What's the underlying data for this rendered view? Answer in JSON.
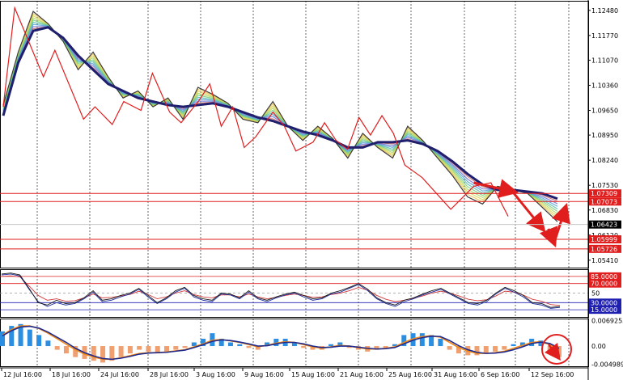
{
  "colors": {
    "background": "#ffffff",
    "price_line": "#3a3a3a",
    "slow_ma": "#1f1f6e",
    "zigzag": "#e01e1e",
    "level_line": "#e01e1e",
    "current_line": "#c8c8c8",
    "rsi_black": "#1a1a1a",
    "rsi_blue": "#1e2f9c",
    "rsi_red": "#d23c3c",
    "macd_pos": "#2b8ee0",
    "macd_neg": "#f0a070",
    "macd_signal": "#f08a1a",
    "macd_line": "#1f2a8e",
    "oscillator_level_line": "#2020b0"
  },
  "chart_data": [
    {
      "type": "line",
      "panel": "main",
      "dates": [
        "12 Jul 16:00",
        "18 Jul 16:00",
        "24 Jul 16:00",
        "28 Jul 16:00",
        "3 Aug 16:00",
        "9 Aug 16:00",
        "15 Aug 16:00",
        "21 Aug 16:00",
        "25 Aug 16:00",
        "31 Aug 16:00",
        "6 Sep 16:00",
        "12 Sep 16:00"
      ],
      "y_ticks": [
        "1.12480",
        "1.11770",
        "1.11070",
        "1.10360",
        "1.09650",
        "1.08950",
        "1.08240",
        "1.07530",
        "1.06830",
        "1.06120",
        "1.05410"
      ],
      "ylim": [
        1.052,
        1.1275
      ],
      "price": [
        1.098,
        1.113,
        1.1245,
        1.121,
        1.116,
        1.108,
        1.113,
        1.106,
        1.1,
        1.102,
        1.0975,
        1.1,
        1.094,
        1.103,
        1.101,
        1.0985,
        1.094,
        1.093,
        1.099,
        1.092,
        1.088,
        1.092,
        1.0885,
        1.083,
        1.09,
        1.086,
        1.083,
        1.092,
        1.088,
        1.083,
        1.078,
        1.072,
        1.07,
        1.075,
        1.074,
        1.073,
        1.069,
        1.065
      ],
      "slow_ma": [
        1.095,
        1.11,
        1.119,
        1.12,
        1.117,
        1.112,
        1.108,
        1.104,
        1.102,
        1.1,
        1.099,
        1.098,
        1.0975,
        1.098,
        1.0985,
        1.0975,
        1.096,
        1.0945,
        1.0935,
        1.092,
        1.0905,
        1.0895,
        1.088,
        1.086,
        1.086,
        1.0875,
        1.0875,
        1.088,
        1.087,
        1.085,
        1.082,
        1.0785,
        1.0755,
        1.074,
        1.074,
        1.0735,
        1.073,
        1.0715
      ],
      "zigzag_points": [
        [
          0,
          1.0975
        ],
        [
          2,
          1.1255
        ],
        [
          7,
          1.106
        ],
        [
          9,
          1.1135
        ],
        [
          14,
          1.094
        ],
        [
          16,
          1.0975
        ],
        [
          19,
          1.0925
        ],
        [
          21,
          1.099
        ],
        [
          24,
          1.0965
        ],
        [
          26,
          1.107
        ],
        [
          29,
          1.096
        ],
        [
          31,
          1.093
        ],
        [
          34,
          1.099
        ],
        [
          36,
          1.104
        ],
        [
          38,
          1.092
        ],
        [
          40,
          1.0975
        ],
        [
          42,
          1.086
        ],
        [
          44,
          1.089
        ],
        [
          47,
          1.096
        ],
        [
          49,
          1.092
        ],
        [
          51,
          1.085
        ],
        [
          54,
          1.0875
        ],
        [
          56,
          1.093
        ],
        [
          58,
          1.088
        ],
        [
          60,
          1.0855
        ],
        [
          62,
          1.0945
        ],
        [
          64,
          1.0895
        ],
        [
          66,
          1.095
        ],
        [
          68,
          1.09
        ],
        [
          70,
          1.081
        ],
        [
          73,
          1.0775
        ],
        [
          78,
          1.0685
        ],
        [
          82,
          1.075
        ],
        [
          85,
          1.076
        ],
        [
          88,
          1.0665
        ]
      ],
      "projection_arrows": [
        {
          "from": [
            82,
            1.076
          ],
          "to": [
            89,
            1.0735
          ]
        },
        {
          "from": [
            89,
            1.073
          ],
          "to": [
            94,
            1.063
          ]
        },
        {
          "from": [
            95,
            1.063
          ],
          "to": [
            96,
            1.059
          ]
        },
        {
          "from": [
            96,
            1.059
          ],
          "to": [
            98,
            1.069
          ]
        }
      ],
      "level_lines": [
        {
          "value": 1.073,
          "label": "1.07309"
        },
        {
          "value": 1.0707,
          "label": "1.07073"
        },
        {
          "value": 1.06,
          "label": "1.05999"
        },
        {
          "value": 1.0573,
          "label": "1.05726"
        }
      ],
      "current_price": {
        "value": 1.0642,
        "label": "1.06423"
      }
    },
    {
      "type": "line",
      "panel": "oscillator",
      "y_ticks": [
        "85.0000",
        "70.0000",
        "50",
        "30.0000",
        "15.0000"
      ],
      "ylim": [
        0,
        100
      ],
      "levels": [
        85,
        70,
        50,
        30,
        15
      ],
      "series_black": [
        90,
        92,
        88,
        60,
        30,
        25,
        35,
        28,
        30,
        40,
        55,
        35,
        38,
        45,
        50,
        60,
        45,
        30,
        40,
        55,
        62,
        45,
        38,
        35,
        50,
        48,
        40,
        55,
        40,
        35,
        42,
        48,
        52,
        45,
        38,
        40,
        50,
        55,
        62,
        70,
        58,
        40,
        30,
        25,
        35,
        40,
        48,
        55,
        60,
        50,
        40,
        30,
        28,
        35,
        50,
        62,
        55,
        45,
        30,
        28,
        20,
        22
      ],
      "series_blue": [
        88,
        90,
        86,
        58,
        32,
        22,
        30,
        25,
        28,
        38,
        52,
        32,
        35,
        42,
        48,
        58,
        42,
        28,
        38,
        52,
        60,
        42,
        35,
        32,
        48,
        46,
        38,
        52,
        38,
        32,
        40,
        46,
        50,
        42,
        35,
        38,
        48,
        52,
        60,
        68,
        55,
        38,
        28,
        22,
        32,
        38,
        46,
        52,
        58,
        48,
        38,
        28,
        25,
        32,
        48,
        60,
        52,
        42,
        28,
        25,
        18,
        20
      ],
      "series_red": [
        85,
        86,
        84,
        65,
        45,
        35,
        38,
        33,
        34,
        40,
        48,
        40,
        41,
        44,
        47,
        54,
        47,
        38,
        42,
        50,
        55,
        47,
        42,
        40,
        46,
        46,
        42,
        48,
        42,
        38,
        41,
        45,
        48,
        45,
        41,
        42,
        47,
        50,
        55,
        62,
        56,
        45,
        37,
        32,
        35,
        39,
        44,
        50,
        54,
        50,
        44,
        37,
        34,
        36,
        44,
        54,
        52,
        46,
        37,
        33,
        26,
        24
      ]
    },
    {
      "type": "bar",
      "panel": "histogram",
      "y_ticks": [
        "0.0069255",
        "0.00",
        "-0.0049898"
      ],
      "ylim": [
        -0.0055,
        0.0075
      ],
      "bars": [
        0.004,
        0.0055,
        0.006,
        0.0045,
        0.003,
        0.0015,
        -0.001,
        -0.002,
        -0.003,
        -0.0035,
        -0.004,
        -0.0045,
        -0.004,
        -0.003,
        -0.002,
        -0.001,
        -0.0015,
        -0.002,
        -0.0015,
        -0.001,
        -0.0005,
        0.001,
        0.002,
        0.0035,
        0.002,
        0.001,
        0.0005,
        -0.0005,
        -0.001,
        0.001,
        0.002,
        0.002,
        0.001,
        -0.0005,
        -0.001,
        -0.001,
        0.0005,
        0.001,
        -0.0005,
        -0.001,
        -0.0015,
        -0.001,
        -0.0005,
        0.0005,
        0.003,
        0.0035,
        0.0035,
        0.003,
        0.002,
        -0.001,
        -0.002,
        -0.0025,
        -0.0025,
        -0.002,
        -0.0015,
        -0.001,
        0.0005,
        0.001,
        0.002,
        0.0015,
        -0.002,
        -0.003
      ],
      "signal": [
        0.003,
        0.0045,
        0.0055,
        0.0055,
        0.0048,
        0.0035,
        0.002,
        0.0005,
        -0.001,
        -0.0022,
        -0.003,
        -0.0036,
        -0.0036,
        -0.0032,
        -0.0026,
        -0.002,
        -0.0018,
        -0.0018,
        -0.0016,
        -0.0013,
        -0.001,
        -0.0002,
        0.0006,
        0.0016,
        0.0018,
        0.0014,
        0.001,
        0.0004,
        -0.0002,
        0.0002,
        0.0008,
        0.0012,
        0.001,
        0.0004,
        -0.0002,
        -0.0006,
        -0.0002,
        0.0002,
        0,
        -0.0004,
        -0.0008,
        -0.0008,
        -0.0006,
        -0.0002,
        0.001,
        0.002,
        0.0026,
        0.0028,
        0.0024,
        0.001,
        -0.0004,
        -0.0014,
        -0.002,
        -0.002,
        -0.0018,
        -0.0014,
        -0.0006,
        0.0002,
        0.001,
        0.0012,
        0.0004,
        -0.001
      ],
      "macd": [
        0.0028,
        0.0042,
        0.0052,
        0.0054,
        0.0049,
        0.0038,
        0.0024,
        0.001,
        -0.0006,
        -0.0018,
        -0.0027,
        -0.0034,
        -0.0036,
        -0.0033,
        -0.0028,
        -0.0022,
        -0.0019,
        -0.0018,
        -0.0017,
        -0.0014,
        -0.0011,
        -0.0004,
        0.0004,
        0.0013,
        0.0017,
        0.0015,
        0.0011,
        0.0006,
        0,
        0.0001,
        0.0006,
        0.001,
        0.001,
        0.0006,
        0,
        -0.0004,
        -0.0003,
        0,
        0,
        -0.0003,
        -0.0006,
        -0.0008,
        -0.0007,
        -0.0004,
        0.0006,
        0.0016,
        0.0023,
        0.0027,
        0.0026,
        0.0015,
        0.0001,
        -0.001,
        -0.0017,
        -0.002,
        -0.0019,
        -0.0016,
        -0.001,
        -0.0002,
        0.0007,
        0.0011,
        0.0007,
        -0.0006
      ]
    }
  ]
}
